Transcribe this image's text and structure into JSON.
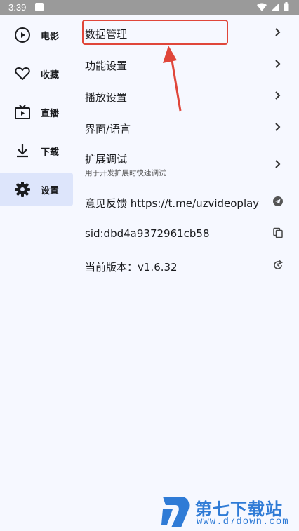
{
  "status_bar": {
    "time": "3:39"
  },
  "sidebar": {
    "items": [
      {
        "label": "电影",
        "icon": "play-circle-icon"
      },
      {
        "label": "收藏",
        "icon": "heart-icon"
      },
      {
        "label": "直播",
        "icon": "tv-icon"
      },
      {
        "label": "下载",
        "icon": "download-icon"
      },
      {
        "label": "设置",
        "icon": "gear-icon",
        "active": true
      }
    ]
  },
  "settings": {
    "items": [
      {
        "title": "数据管理",
        "trailing": "chevron-right-icon"
      },
      {
        "title": "功能设置",
        "trailing": "chevron-right-icon"
      },
      {
        "title": "播放设置",
        "trailing": "chevron-right-icon"
      },
      {
        "title": "界面/语言",
        "trailing": "chevron-right-icon"
      },
      {
        "title": "扩展调试",
        "subtitle": "用于开发扩展时快速调试",
        "trailing": "chevron-right-icon"
      },
      {
        "title": "意见反馈 https://t.me/uzvideoplay",
        "trailing": "telegram-icon"
      },
      {
        "title": "sid:dbd4a9372961cb58",
        "trailing": "copy-icon"
      },
      {
        "title": "当前版本：v1.6.32",
        "trailing": "update-icon"
      }
    ]
  },
  "watermark": {
    "name": "第七下载站",
    "url": "www.d7down.com"
  },
  "colors": {
    "accent_bg": "#dde5fb",
    "highlight": "#e0463a",
    "watermark": "#2f7bd6"
  }
}
